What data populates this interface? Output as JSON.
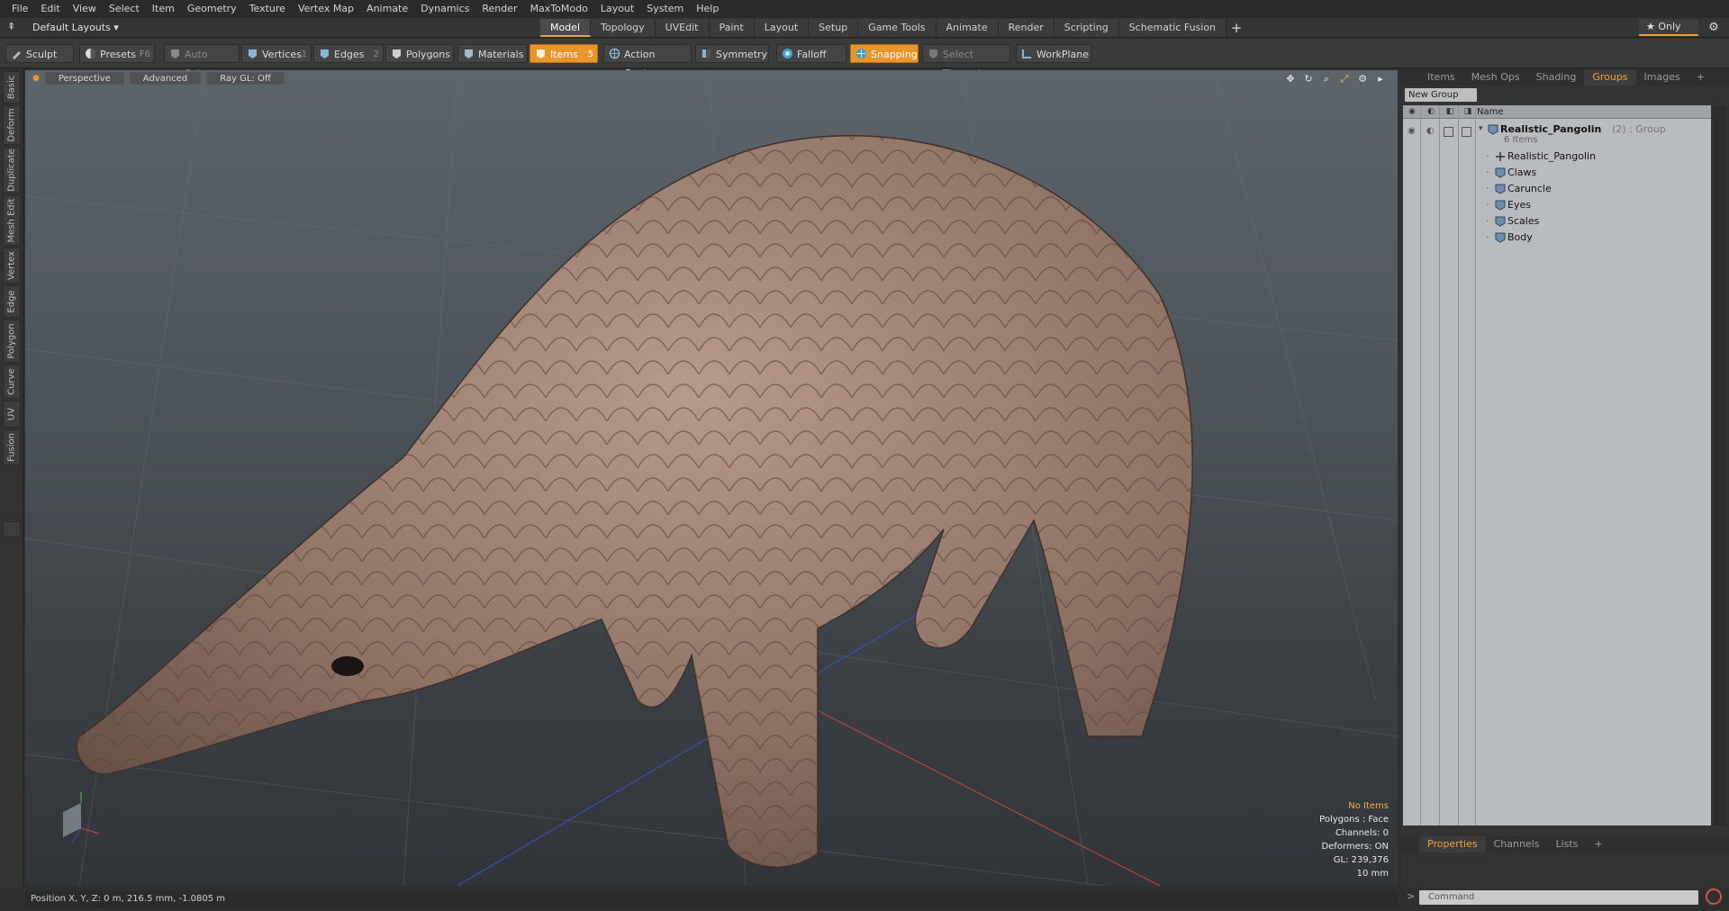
{
  "menubar": [
    "File",
    "Edit",
    "View",
    "Select",
    "Item",
    "Geometry",
    "Texture",
    "Vertex Map",
    "Animate",
    "Dynamics",
    "Render",
    "MaxToModo",
    "Layout",
    "System",
    "Help"
  ],
  "layout": {
    "selector": "Default Layouts ▾"
  },
  "tabs": [
    "Model",
    "Topology",
    "UVEdit",
    "Paint",
    "Layout",
    "Setup",
    "Game Tools",
    "Animate",
    "Render",
    "Scripting",
    "Schematic Fusion"
  ],
  "active_tab": "Model",
  "only_label": "★ Only",
  "toolbar": {
    "sculpt": "Sculpt",
    "presets": "Presets",
    "presets_key": "F6",
    "auto_select": "Auto Select",
    "vertices": "Vertices",
    "vertices_key": "1",
    "edges": "Edges",
    "edges_key": "2",
    "polygons": "Polygons",
    "materials": "Materials",
    "items": "Items",
    "items_key": "5",
    "action_center": "Action Center",
    "symmetry": "Symmetry",
    "falloff": "Falloff",
    "snapping": "Snapping",
    "select_through": "Select Through",
    "workplane": "WorkPlane"
  },
  "left_tabs": [
    "Basic",
    "Deform",
    "Duplicate",
    "Mesh Edit",
    "Vertex",
    "Edge",
    "Polygon",
    "Curve",
    "UV",
    "Fusion"
  ],
  "viewport": {
    "view_mode": "Perspective",
    "shading": "Advanced",
    "raygl": "Ray GL: Off",
    "info": {
      "no_items": "No Items",
      "polygons": "Polygons : Face",
      "channels": "Channels: 0",
      "deformers": "Deformers: ON",
      "gl": "GL: 239,376",
      "scale": "10 mm"
    }
  },
  "right_panel": {
    "tabs": [
      "Items",
      "Mesh Ops",
      "Shading",
      "Groups",
      "Images"
    ],
    "active_tab": "Groups",
    "new_group": "New Group",
    "column_name": "Name",
    "group": {
      "name": "Realistic_Pangolin",
      "suffix": "(2) : Group",
      "count": "6 Items"
    },
    "items": [
      "Realistic_Pangolin",
      "Claws",
      "Caruncle",
      "Eyes",
      "Scales",
      "Body"
    ],
    "bottom_tabs": [
      "Properties",
      "Channels",
      "Lists"
    ],
    "bottom_active": "Properties",
    "command_placeholder": "Command"
  },
  "status": "Position X, Y, Z:   0 m, 216.5 mm, -1.0805 m",
  "colors": {
    "accent": "#e8952c",
    "active_tab_text": "#f2a13a"
  }
}
